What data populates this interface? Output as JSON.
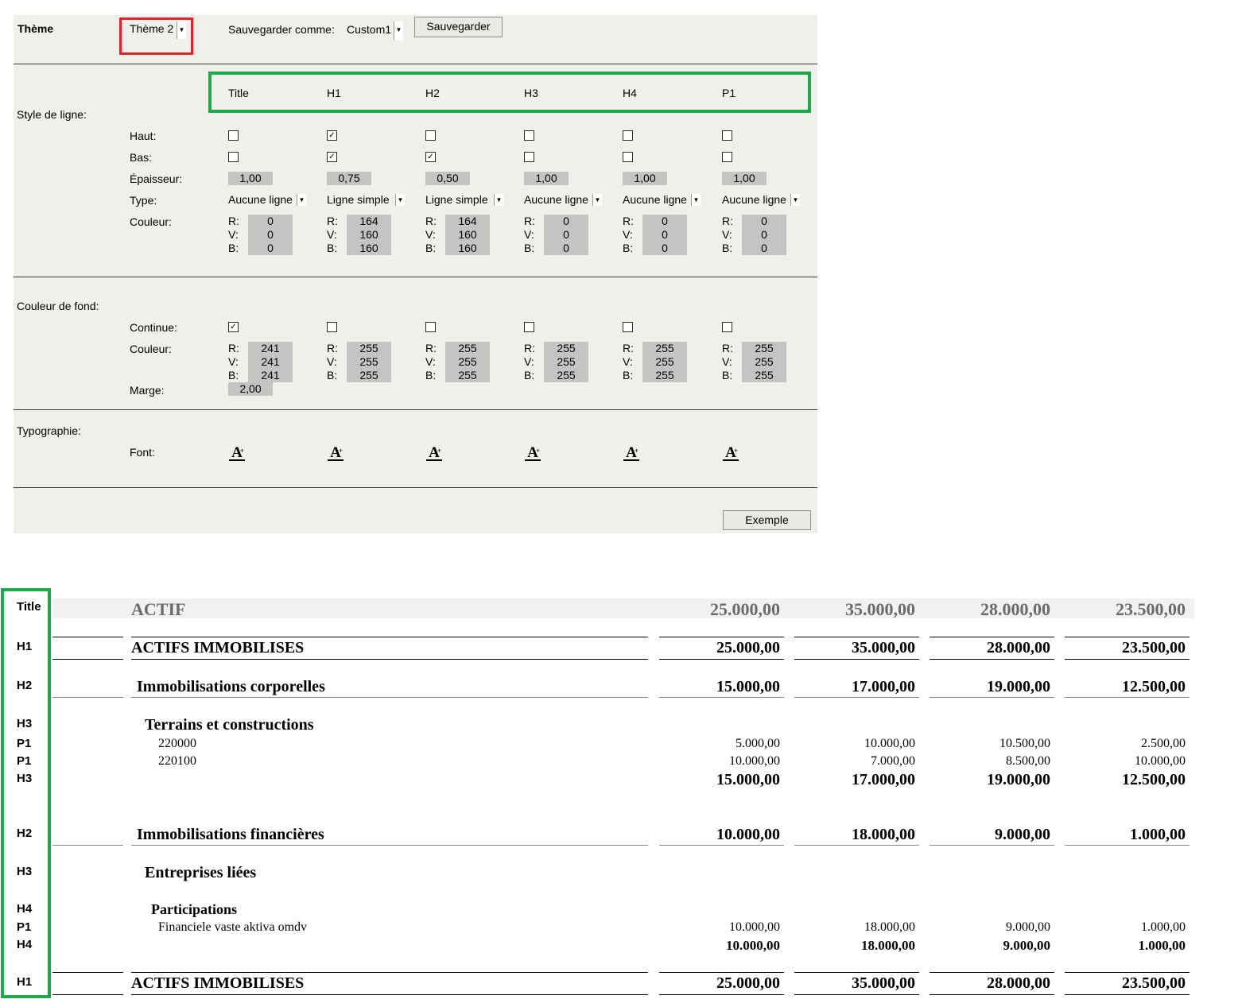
{
  "theme": {
    "label": "Thème",
    "selected": "Thème 2",
    "save_as_label": "Sauvegarder comme:",
    "save_as_value": "Custom1",
    "save_button": "Sauvegarder"
  },
  "columns": [
    "Title",
    "H1",
    "H2",
    "H3",
    "H4",
    "P1"
  ],
  "line_style": {
    "section_label": "Style de ligne:",
    "top_label": "Haut:",
    "bottom_label": "Bas:",
    "thickness_label": "Épaisseur:",
    "type_label": "Type:",
    "color_label": "Couleur:",
    "top": [
      false,
      true,
      false,
      false,
      false,
      false
    ],
    "bottom": [
      false,
      true,
      true,
      false,
      false,
      false
    ],
    "thickness": [
      "1,00",
      "0,75",
      "0,50",
      "1,00",
      "1,00",
      "1,00"
    ],
    "type": [
      "Aucune ligne",
      "Ligne simple",
      "Ligne simple",
      "Aucune ligne",
      "Aucune ligne",
      "Aucune ligne"
    ],
    "colors": [
      {
        "r": "0",
        "v": "0",
        "b": "0"
      },
      {
        "r": "164",
        "v": "160",
        "b": "160"
      },
      {
        "r": "164",
        "v": "160",
        "b": "160"
      },
      {
        "r": "0",
        "v": "0",
        "b": "0"
      },
      {
        "r": "0",
        "v": "0",
        "b": "0"
      },
      {
        "r": "0",
        "v": "0",
        "b": "0"
      }
    ]
  },
  "rgb_labels": {
    "r": "R:",
    "v": "V:",
    "b": "B:"
  },
  "background": {
    "section_label": "Couleur de fond:",
    "continuous_label": "Continue:",
    "color_label": "Couleur:",
    "margin_label": "Marge:",
    "continuous": [
      true,
      false,
      false,
      false,
      false,
      false
    ],
    "colors": [
      {
        "r": "241",
        "v": "241",
        "b": "241"
      },
      {
        "r": "255",
        "v": "255",
        "b": "255"
      },
      {
        "r": "255",
        "v": "255",
        "b": "255"
      },
      {
        "r": "255",
        "v": "255",
        "b": "255"
      },
      {
        "r": "255",
        "v": "255",
        "b": "255"
      },
      {
        "r": "255",
        "v": "255",
        "b": "255"
      }
    ],
    "margin": "2,00"
  },
  "typography": {
    "section_label": "Typographie:",
    "font_label": "Font:",
    "font_icon_glyph": "A",
    "font_icon_mark": "+"
  },
  "example_button": "Exemple",
  "colors": {
    "panel_bg": "#f0f0ea",
    "box_bg": "#c4c4c4",
    "highlight_red": "#e0242c",
    "highlight_green": "#1ea84a",
    "title_row_bg": "#f1f1f1",
    "title_text": "#6b6b6b"
  },
  "example": {
    "rows": [
      {
        "style": "Title",
        "label": "ACTIF",
        "values": [
          "25.000,00",
          "35.000,00",
          "28.000,00",
          "23.500,00"
        ]
      },
      {
        "style": "H1",
        "label": "ACTIFS IMMOBILISES",
        "values": [
          "25.000,00",
          "35.000,00",
          "28.000,00",
          "23.500,00"
        ]
      },
      {
        "style": "H2",
        "label": "Immobilisations corporelles",
        "values": [
          "15.000,00",
          "17.000,00",
          "19.000,00",
          "12.500,00"
        ]
      },
      {
        "style": "H3",
        "label": "Terrains et constructions",
        "values": [
          "",
          "",
          "",
          ""
        ]
      },
      {
        "style": "P1",
        "label": "220000",
        "values": [
          "5.000,00",
          "10.000,00",
          "10.500,00",
          "2.500,00"
        ]
      },
      {
        "style": "P1",
        "label": "220100",
        "values": [
          "10.000,00",
          "7.000,00",
          "8.500,00",
          "10.000,00"
        ]
      },
      {
        "style": "H3",
        "label": "",
        "values": [
          "15.000,00",
          "17.000,00",
          "19.000,00",
          "12.500,00"
        ]
      },
      {
        "style": "H2",
        "label": "Immobilisations financières",
        "values": [
          "10.000,00",
          "18.000,00",
          "9.000,00",
          "1.000,00"
        ]
      },
      {
        "style": "H3",
        "label": "Entreprises liées",
        "values": [
          "",
          "",
          "",
          ""
        ]
      },
      {
        "style": "H4",
        "label": "Participations",
        "values": [
          "",
          "",
          "",
          ""
        ]
      },
      {
        "style": "P1",
        "label": "Financiele vaste aktiva omdv",
        "values": [
          "10.000,00",
          "18.000,00",
          "9.000,00",
          "1.000,00"
        ]
      },
      {
        "style": "H4",
        "label": "",
        "values": [
          "10.000,00",
          "18.000,00",
          "9.000,00",
          "1.000,00"
        ]
      },
      {
        "style": "H1",
        "label": "ACTIFS IMMOBILISES",
        "values": [
          "25.000,00",
          "35.000,00",
          "28.000,00",
          "23.500,00"
        ]
      }
    ]
  }
}
